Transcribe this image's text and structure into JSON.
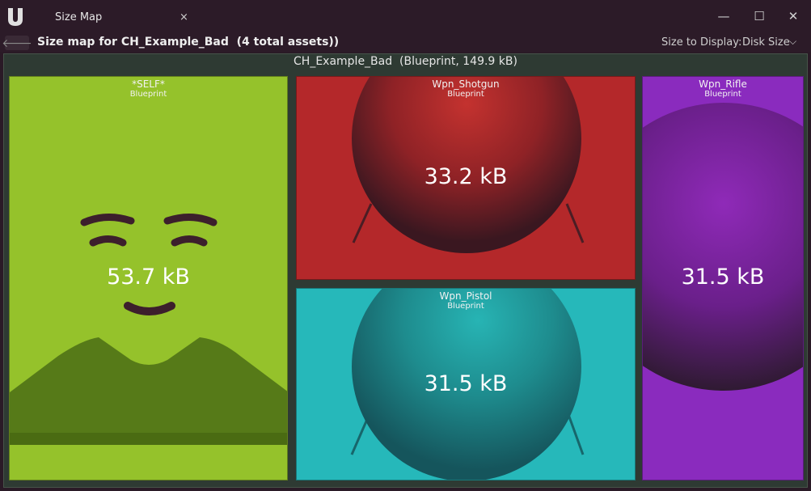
{
  "window": {
    "tab_title": "Size Map",
    "tab_close": "×",
    "minimize": "—",
    "maximize": "☐",
    "close": "✕"
  },
  "toolbar": {
    "back": "🡐",
    "title": "Size map for CH_Example_Bad  (4 total assets))",
    "size_to_display_label": "Size to Display:",
    "size_to_display_value": "Disk Size",
    "chevron": "⌵"
  },
  "map": {
    "root_title": "CH_Example_Bad  (Blueprint, 149.9 kB)",
    "nodes": [
      {
        "name": "*SELF*",
        "type": "Blueprint",
        "size": "53.7 kB",
        "color": "#95c22b",
        "thumbnail": "character-face"
      },
      {
        "name": "Wpn_Shotgun",
        "type": "Blueprint",
        "size": "33.2 kB",
        "color": "#b4282a",
        "thumbnail": "sphere"
      },
      {
        "name": "Wpn_Pistol",
        "type": "Blueprint",
        "size": "31.5 kB",
        "color": "#26b8ba",
        "thumbnail": "sphere"
      },
      {
        "name": "Wpn_Rifle",
        "type": "Blueprint",
        "size": "31.5 kB",
        "color": "#8a2bbe",
        "thumbnail": "sphere"
      }
    ]
  }
}
